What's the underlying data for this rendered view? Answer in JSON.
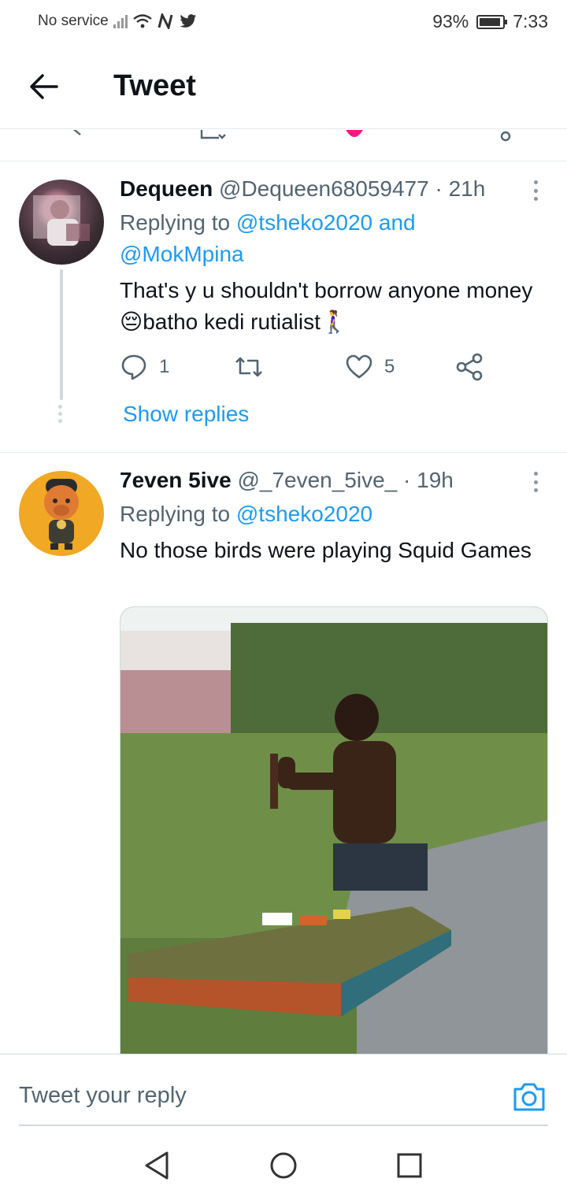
{
  "status_bar": {
    "carrier": "No service",
    "battery": "93%",
    "time": "7:33"
  },
  "header": {
    "title": "Tweet"
  },
  "tweets": [
    {
      "name": "Dequeen",
      "meta": "@Dequeen68059477 · 21h",
      "replying_prefix": "Replying to",
      "mention_1": "@tsheko2020",
      "joiner": "and",
      "mention_2": "@MokMpina",
      "text": "That's y u shouldn't borrow anyone money😔batho kedi rutialist🚶‍♀️",
      "reply_count": "1",
      "like_count": "5",
      "show_replies": "Show replies"
    },
    {
      "name": "7even 5ive",
      "meta": "@_7even_5ive_ · 19h",
      "replying_prefix": "Replying to",
      "mention_1": "@tsheko2020",
      "text": "No those birds were playing Squid Games"
    }
  ],
  "reply_bar": {
    "placeholder": "Tweet your reply"
  },
  "colors": {
    "accent": "#1d9bf0",
    "secondary_text": "#536471",
    "divider": "#e6ecf0"
  },
  "icons": [
    "back-arrow-icon",
    "reply-icon",
    "retweet-icon",
    "like-icon",
    "share-icon",
    "more-icon",
    "camera-icon",
    "nav-back-icon",
    "nav-home-icon",
    "nav-recents-icon"
  ]
}
